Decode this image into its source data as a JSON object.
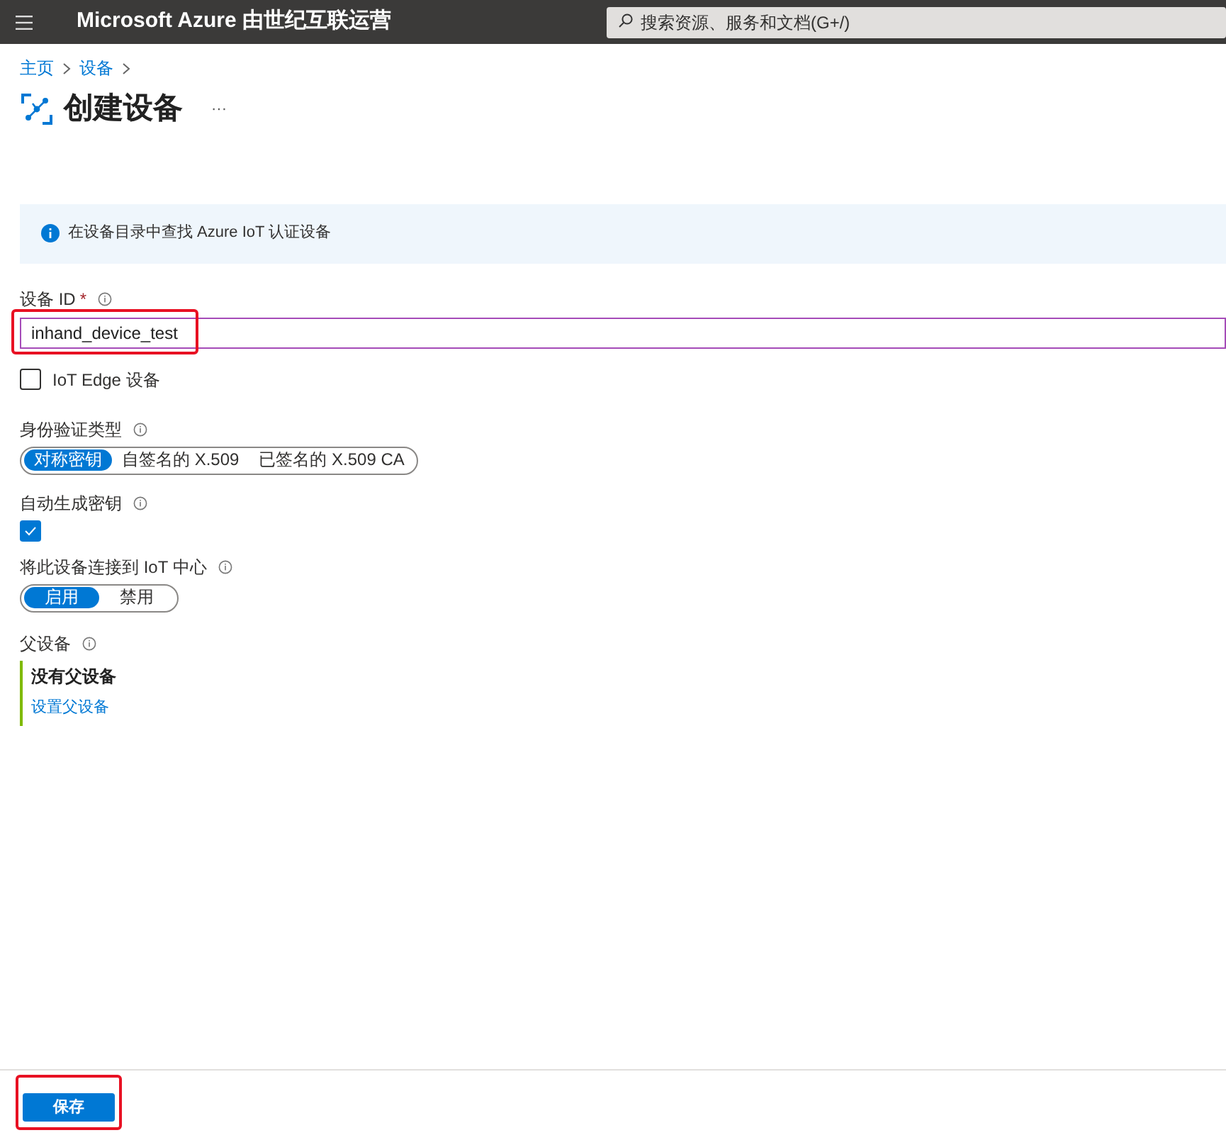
{
  "header": {
    "title": "Microsoft Azure 由世纪互联运营",
    "search": {
      "placeholder": "搜索资源、服务和文档(G+/)"
    }
  },
  "breadcrumb": [
    "主页",
    "设备"
  ],
  "page": {
    "title": "创建设备",
    "more": "···"
  },
  "info_banner": "在设备目录中查找 Azure IoT 认证设备",
  "device_id": {
    "label": "设备 ID",
    "required": "*",
    "value": "inhand_device_test",
    "highlighted": true
  },
  "iot_edge": {
    "label": "IoT Edge 设备",
    "checked": false
  },
  "auth_type": {
    "label": "身份验证类型",
    "options": [
      {
        "label": "对称密钥",
        "selected": true
      },
      {
        "label": "自签名的 X.509",
        "selected": false
      },
      {
        "label": "已签名的 X.509 CA",
        "selected": false
      }
    ]
  },
  "auto_generate": {
    "label": "自动生成密钥",
    "checked": true
  },
  "connect": {
    "label": "将此设备连接到 IoT 中心",
    "options": [
      {
        "label": "启用",
        "selected": true
      },
      {
        "label": "禁用",
        "selected": false
      }
    ]
  },
  "parent": {
    "label": "父设备",
    "value": "没有父设备",
    "link": "设置父设备"
  },
  "save": {
    "label": "保存",
    "highlighted": true
  }
}
